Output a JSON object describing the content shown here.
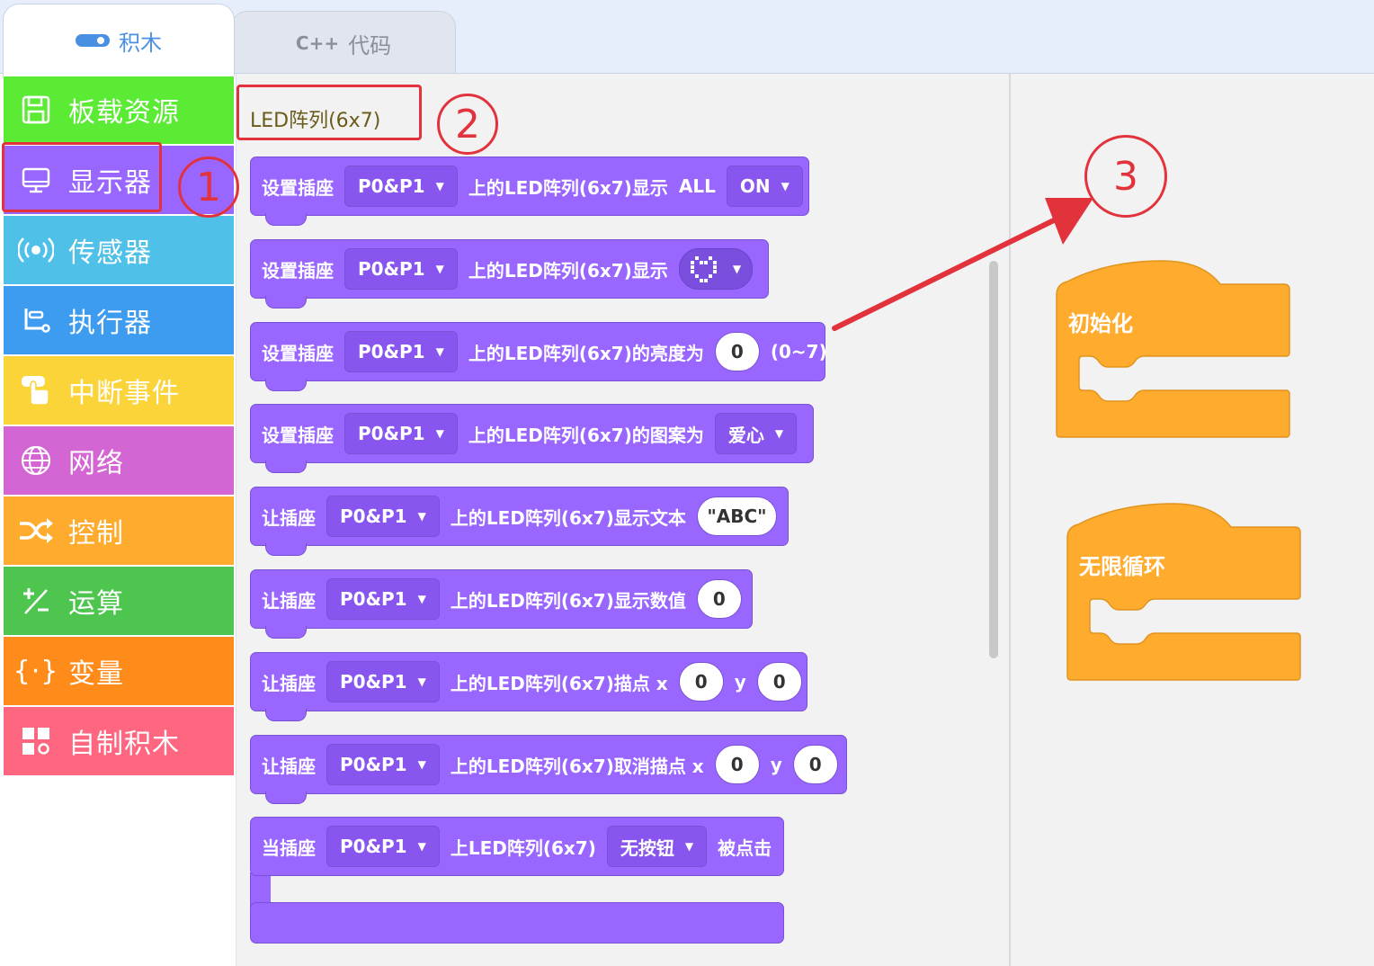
{
  "tabs": {
    "blocks_label": "积木",
    "code_label": "代码",
    "code_icon_text": "C++"
  },
  "categories": [
    {
      "label": "板载资源",
      "color": "#5ceb35",
      "icon": "floppy-icon",
      "glyph": "🖫"
    },
    {
      "label": "显示器",
      "color": "#9966ff",
      "icon": "monitor-icon",
      "glyph": "🖵"
    },
    {
      "label": "传感器",
      "color": "#4fc0e8",
      "icon": "radio-waves-icon",
      "glyph": "((•))"
    },
    {
      "label": "执行器",
      "color": "#3d9bf0",
      "icon": "actuator-icon",
      "glyph": "⌐"
    },
    {
      "label": "中断事件",
      "color": "#fbd43a",
      "icon": "hand-touch-icon",
      "glyph": "☝"
    },
    {
      "label": "网络",
      "color": "#d366d3",
      "icon": "globe-icon",
      "glyph": "⊕"
    },
    {
      "label": "控制",
      "color": "#ffab2e",
      "icon": "shuffle-icon",
      "glyph": "⤨"
    },
    {
      "label": "运算",
      "color": "#4ec54f",
      "icon": "math-icon",
      "glyph": "⁺⁄₋"
    },
    {
      "label": "变量",
      "color": "#ff8c1a",
      "icon": "braces-icon",
      "glyph": "{·}"
    },
    {
      "label": "自制积木",
      "color": "#ff6680",
      "icon": "custom-blocks-icon",
      "glyph": "▦"
    }
  ],
  "palette": {
    "section_title": "LED阵列(6x7)",
    "blocks": [
      {
        "prefix": "设置插座",
        "port": "P0&P1",
        "text": "上的LED阵列(6x7)显示",
        "extra": "ALL",
        "dropdown2": "ON"
      },
      {
        "prefix": "设置插座",
        "port": "P0&P1",
        "text": "上的LED阵列(6x7)显示",
        "image_dropdown": "heart-pattern-icon"
      },
      {
        "prefix": "设置插座",
        "port": "P0&P1",
        "text": "上的LED阵列(6x7)的亮度为",
        "value": "0",
        "suffix": "(0~7)"
      },
      {
        "prefix": "设置插座",
        "port": "P0&P1",
        "text": "上的LED阵列(6x7)的图案为",
        "dropdown2": "爱心"
      },
      {
        "prefix": "让插座",
        "port": "P0&P1",
        "text": "上的LED阵列(6x7)显示文本",
        "value": "\"ABC\""
      },
      {
        "prefix": "让插座",
        "port": "P0&P1",
        "text": "上的LED阵列(6x7)显示数值",
        "value": "0"
      },
      {
        "prefix": "让插座",
        "port": "P0&P1",
        "text": "上的LED阵列(6x7)描点 x",
        "value": "0",
        "ylabel": "y",
        "value2": "0"
      },
      {
        "prefix": "让插座",
        "port": "P0&P1",
        "text": "上的LED阵列(6x7)取消描点 x",
        "value": "0",
        "ylabel": "y",
        "value2": "0"
      },
      {
        "prefix": "当插座",
        "port": "P0&P1",
        "text": "上LED阵列(6x7)",
        "dropdown2": "无按钮",
        "suffix": "被点击"
      }
    ]
  },
  "workspace": {
    "init_block": "初始化",
    "loop_block": "无限循环"
  },
  "annotations": {
    "one": "1",
    "two": "2",
    "three": "3"
  },
  "colors": {
    "looks_purple": "#9966ff",
    "event_orange": "#ffab2e",
    "annotation_red": "#e2333d",
    "tab_blue": "#4a90e2"
  }
}
